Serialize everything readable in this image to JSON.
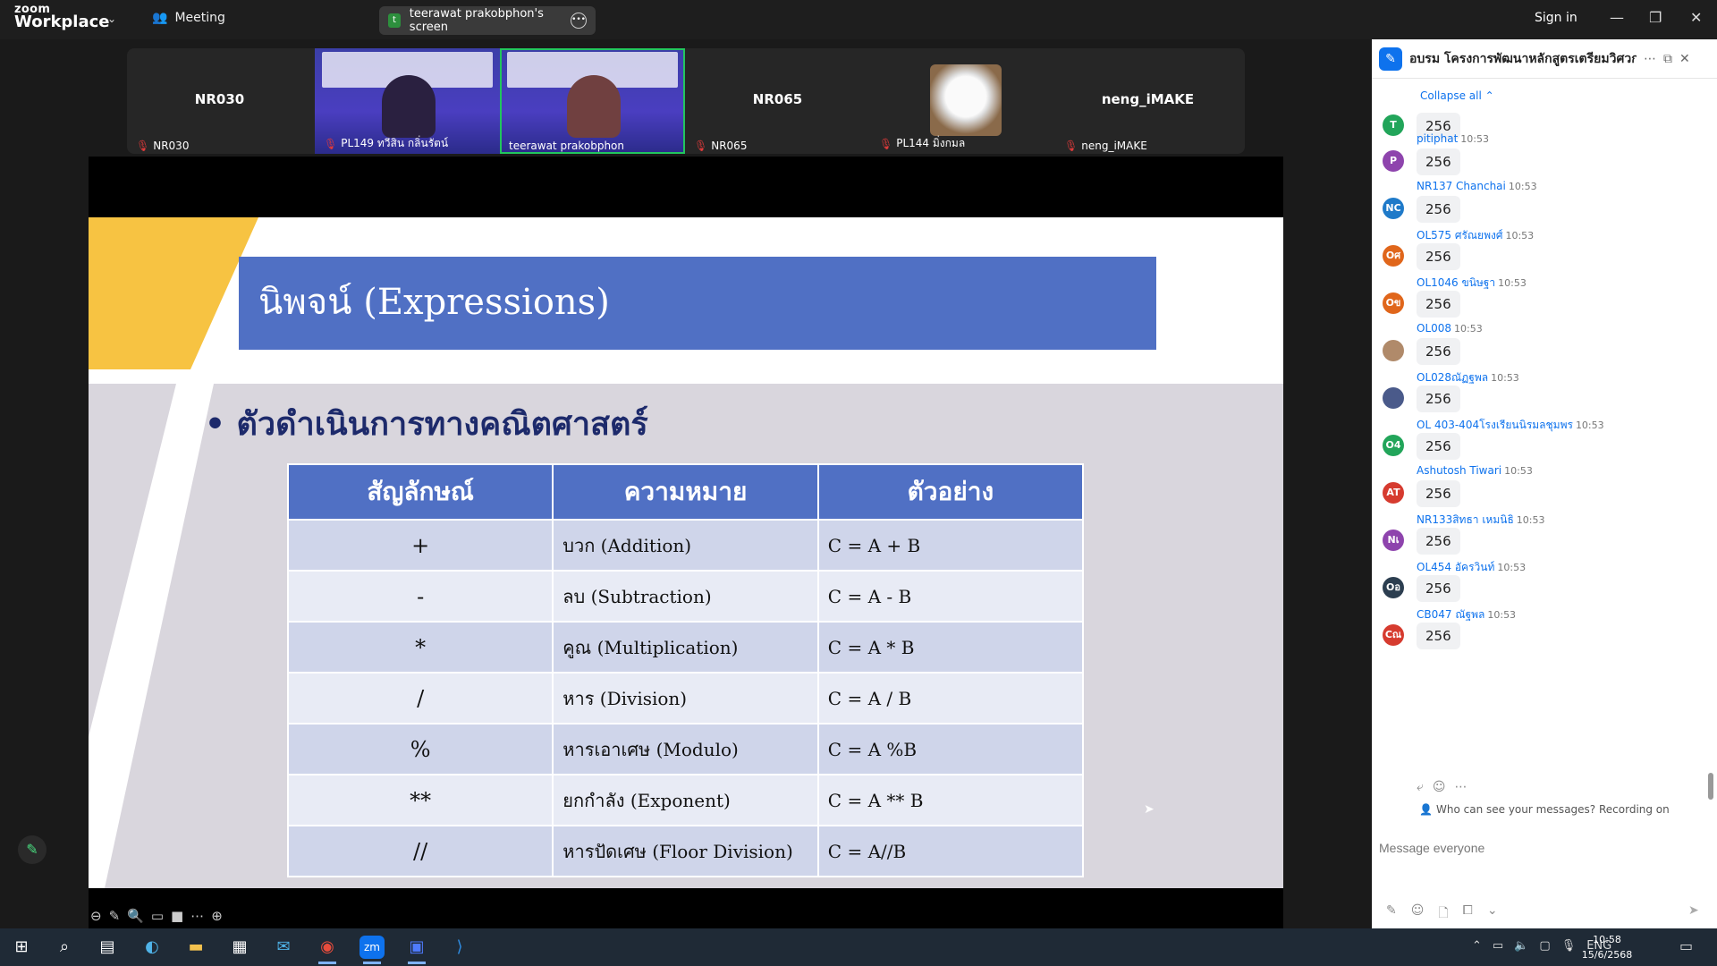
{
  "app": {
    "logo_line1": "zoom",
    "logo_line2": "Workplace",
    "meeting_label": "Meeting",
    "sign_in": "Sign in",
    "accent": "#0e72ed"
  },
  "share_tab": {
    "initial": "t",
    "label": "teerawat prakobphon's screen"
  },
  "participants": [
    {
      "big": "NR030",
      "name": "NR030"
    },
    {
      "big": "",
      "name": "PL149 ทวีสิน กลิ่นรัตน์"
    },
    {
      "big": "",
      "name": "teerawat prakobphon"
    },
    {
      "big": "NR065",
      "name": "NR065"
    },
    {
      "big": "",
      "name": "PL144 มิ่งกมล"
    },
    {
      "big": "neng_iMAKE",
      "name": "neng_iMAKE"
    }
  ],
  "slide": {
    "title": "นิพจน์ (Expressions)",
    "bullet": "ตัวดำเนินการทางคณิตศาสตร์",
    "headers": [
      "สัญลักษณ์",
      "ความหมาย",
      "ตัวอย่าง"
    ],
    "rows": [
      [
        "+",
        "บวก (Addition)",
        "C = A + B"
      ],
      [
        "-",
        " ลบ (Subtraction)",
        "C = A - B"
      ],
      [
        "*",
        "คูณ (Multiplication)",
        "C = A * B"
      ],
      [
        "/",
        "หาร (Division)",
        "C = A / B"
      ],
      [
        "%",
        "หารเอาเศษ (Modulo)",
        "C = A %B"
      ],
      [
        "**",
        "ยกกำลัง (Exponent)",
        "C = A ** B"
      ],
      [
        "//",
        "หารปัดเศษ (Floor Division)",
        "C = A//B"
      ]
    ]
  },
  "chat": {
    "title": "อบรม โครงการพัฒนาหลักสูตรเตรียมวิศวก...",
    "collapse_all": "Collapse all",
    "messages": [
      {
        "initials": "T",
        "color": "#22a55a",
        "sender": "",
        "time": "",
        "text": "256"
      },
      {
        "initials": "P",
        "color": "#8e44ad",
        "sender": "pitiphat",
        "time": "10:53",
        "text": "256"
      },
      {
        "initials": "NC",
        "color": "#1f7ac9",
        "sender": "NR137 Chanchai",
        "time": "10:53",
        "text": "256"
      },
      {
        "initials": "Oศ",
        "color": "#e0661b",
        "sender": "OL575 ศรัณยพงศ์",
        "time": "10:53",
        "text": "256"
      },
      {
        "initials": "Oข",
        "color": "#e0661b",
        "sender": "OL1046 ขนิษฐา",
        "time": "10:53",
        "text": "256"
      },
      {
        "initials": "",
        "color": "#b08a6a",
        "sender": "OL008",
        "time": "10:53",
        "text": "256"
      },
      {
        "initials": "",
        "color": "#4a5a8a",
        "sender": "OL028ณัฏฐพล",
        "time": "10:53",
        "text": "256"
      },
      {
        "initials": "O4",
        "color": "#22a55a",
        "sender": "OL 403-404โรงเรียนนิรมลชุมพร",
        "time": "10:53",
        "text": "256"
      },
      {
        "initials": "AT",
        "color": "#d63b2f",
        "sender": "Ashutosh Tiwari",
        "time": "10:53",
        "text": "256"
      },
      {
        "initials": "Nเ",
        "color": "#8e44ad",
        "sender": "NR133สิทธา เหมนิธิ",
        "time": "10:53",
        "text": "256"
      },
      {
        "initials": "Oอ",
        "color": "#2c3e50",
        "sender": "OL454 อัครวินท์",
        "time": "10:53",
        "text": "256"
      },
      {
        "initials": "Cณ",
        "color": "#d63b2f",
        "sender": "CB047 ณัฐพล",
        "time": "10:53",
        "text": "256"
      }
    ],
    "who_can_see": "Who can see your messages? Recording on",
    "input_placeholder": "Message everyone"
  },
  "taskbar": {
    "lang": "ENG",
    "time": "10:58",
    "date": "15/6/2568"
  }
}
